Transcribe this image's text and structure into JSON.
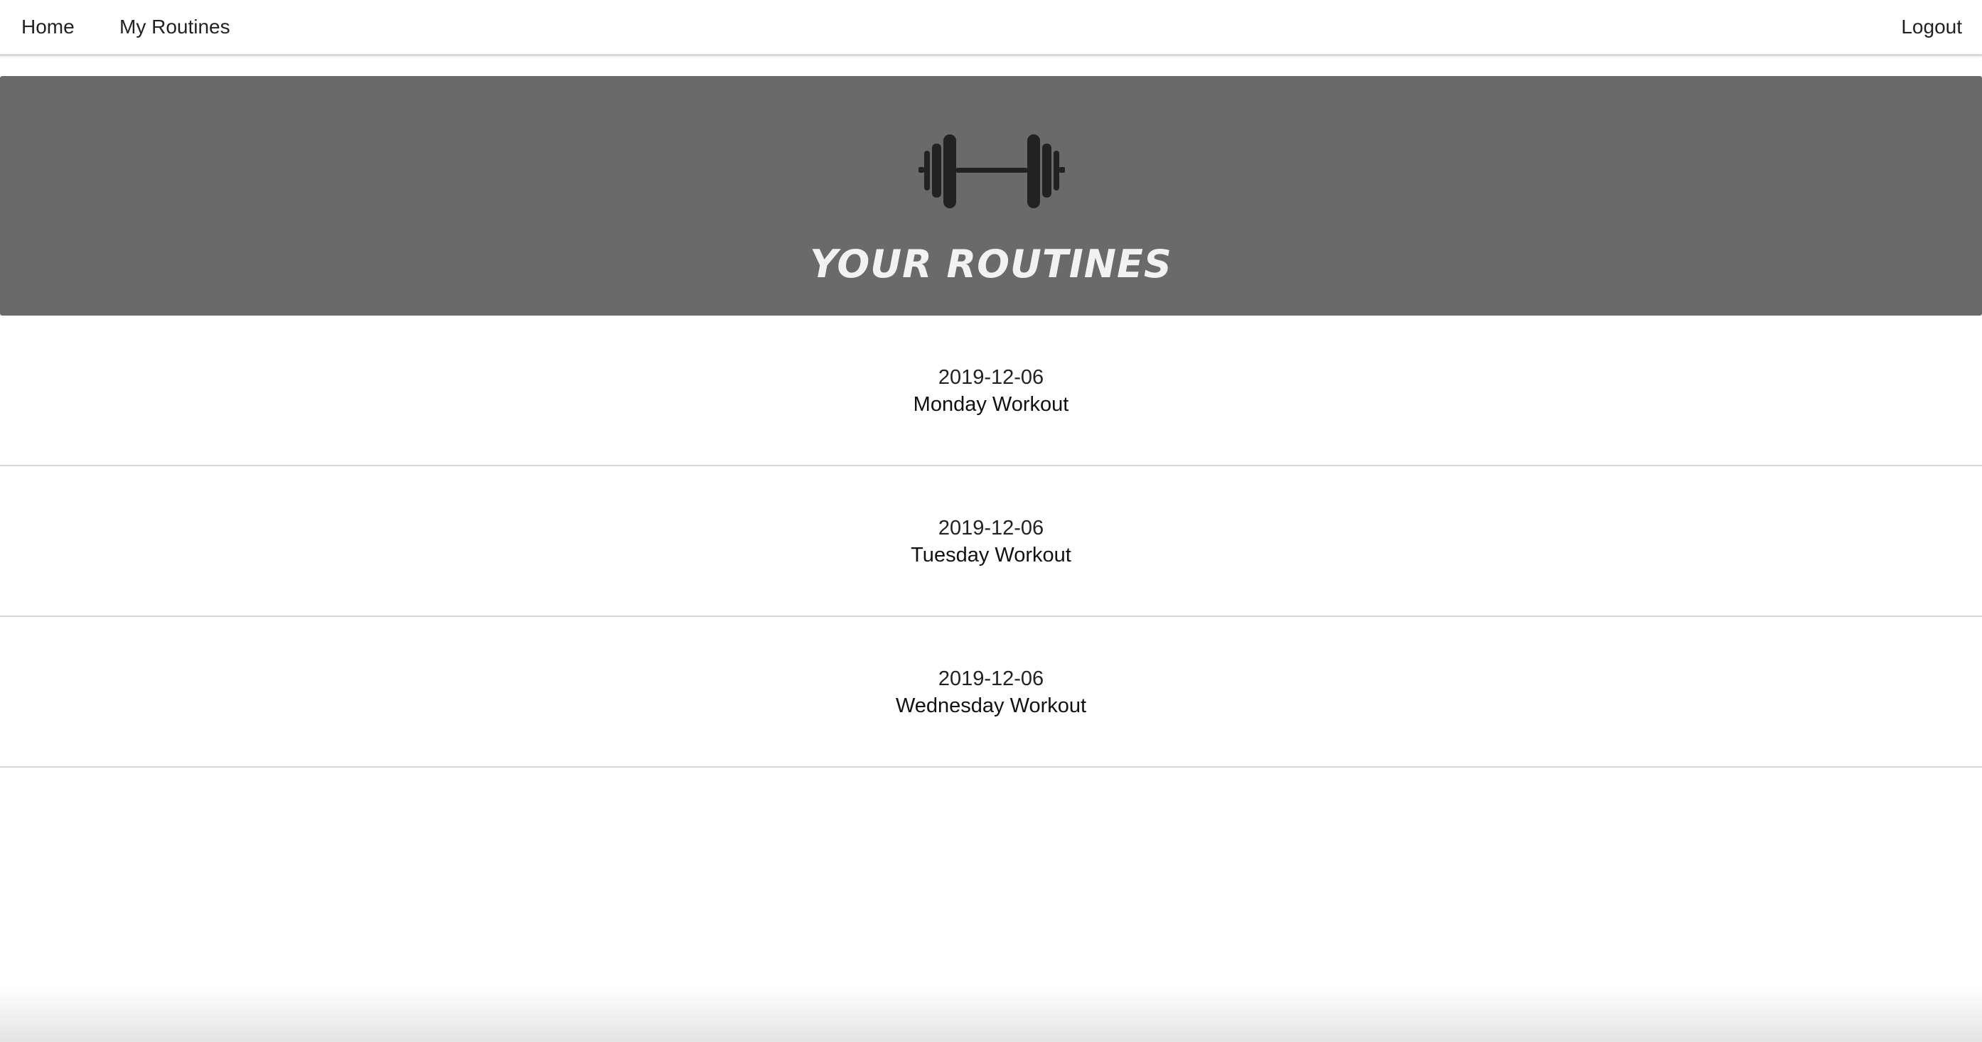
{
  "nav": {
    "home_label": "Home",
    "routines_label": "My Routines",
    "logout_label": "Logout"
  },
  "hero": {
    "icon": "dumbbell-icon",
    "title": "YOUR ROUTINES",
    "background_color": "#6a6a6a"
  },
  "routines": [
    {
      "date": "2019-12-06",
      "name": "Monday Workout"
    },
    {
      "date": "2019-12-06",
      "name": "Tuesday Workout"
    },
    {
      "date": "2019-12-06",
      "name": "Wednesday Workout"
    }
  ]
}
